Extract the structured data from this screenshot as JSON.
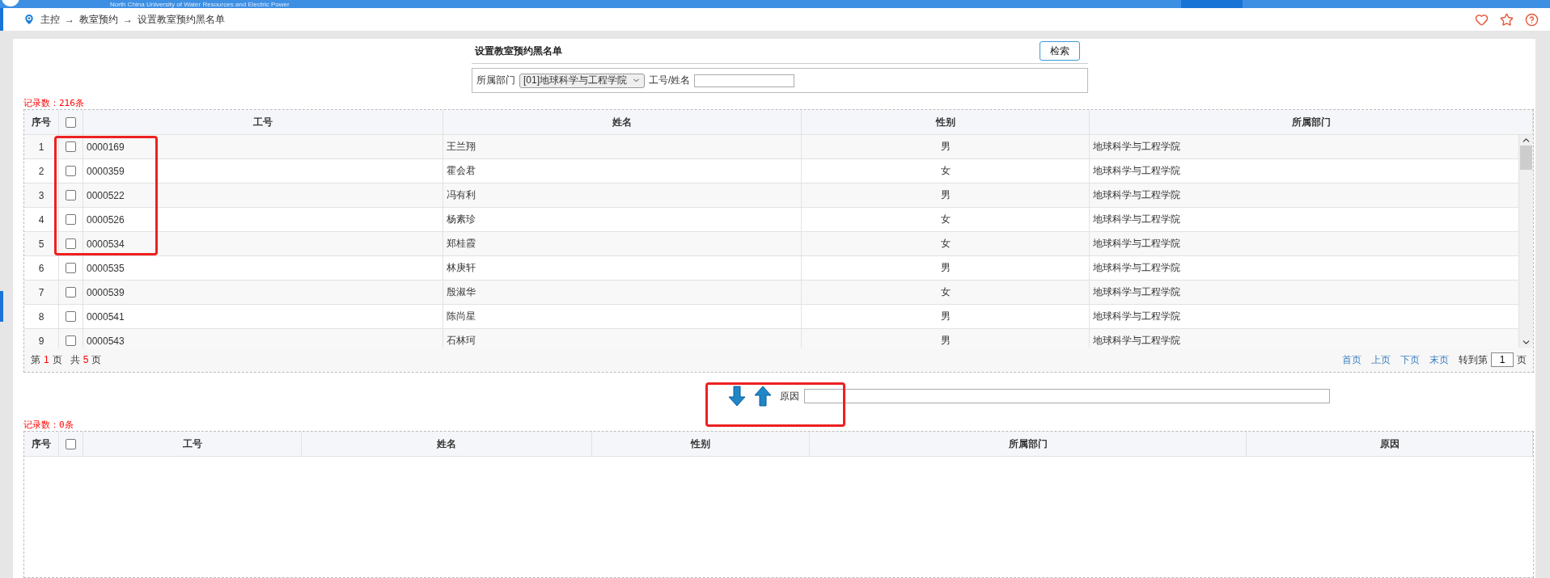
{
  "top_bar": {
    "caption": "North China University of Water Resources and Electric Power"
  },
  "breadcrumb": {
    "items": [
      "主控",
      "教室预约",
      "设置教室预约黑名单"
    ],
    "separators": [
      "→",
      "→"
    ]
  },
  "form": {
    "title": "设置教室预约黑名单",
    "search_button": "检索",
    "department_label": "所属部门",
    "department_value": "[01]地球科学与工程学院",
    "id_name_label": "工号/姓名"
  },
  "candidates": {
    "record_count": "记录数：216条",
    "columns": [
      "序号",
      "工号",
      "姓名",
      "性别",
      "所属部门"
    ],
    "header_checked": false,
    "rows": [
      {
        "index": "1",
        "checked": false,
        "id": "0000169",
        "name": "王兰翔",
        "gender": "男",
        "department": "地球科学与工程学院"
      },
      {
        "index": "2",
        "checked": false,
        "id": "0000359",
        "name": "霍会君",
        "gender": "女",
        "department": "地球科学与工程学院"
      },
      {
        "index": "3",
        "checked": false,
        "id": "0000522",
        "name": "冯有利",
        "gender": "男",
        "department": "地球科学与工程学院"
      },
      {
        "index": "4",
        "checked": false,
        "id": "0000526",
        "name": "杨素珍",
        "gender": "女",
        "department": "地球科学与工程学院"
      },
      {
        "index": "5",
        "checked": false,
        "id": "0000534",
        "name": "郑桂霞",
        "gender": "女",
        "department": "地球科学与工程学院"
      },
      {
        "index": "6",
        "checked": false,
        "id": "0000535",
        "name": "林庚轩",
        "gender": "男",
        "department": "地球科学与工程学院"
      },
      {
        "index": "7",
        "checked": false,
        "id": "0000539",
        "name": "殷淑华",
        "gender": "女",
        "department": "地球科学与工程学院"
      },
      {
        "index": "8",
        "checked": false,
        "id": "0000541",
        "name": "陈尚星",
        "gender": "男",
        "department": "地球科学与工程学院"
      },
      {
        "index": "9",
        "checked": false,
        "id": "0000543",
        "name": "石林珂",
        "gender": "男",
        "department": "地球科学与工程学院"
      }
    ],
    "pager": {
      "page_prefix": "第",
      "current": "1",
      "page_suffix": "页",
      "total_prefix": "共",
      "total": "5",
      "total_suffix": "页",
      "links": [
        "首页",
        "上页",
        "下页",
        "末页"
      ],
      "goto_prefix": "转到第",
      "goto_value": "1",
      "goto_suffix": "页"
    }
  },
  "transfer": {
    "reason_label": "原因"
  },
  "blacklist": {
    "record_count": "记录数：0条",
    "columns": [
      "序号",
      "工号",
      "姓名",
      "性别",
      "所属部门",
      "原因"
    ],
    "header_checked": false
  }
}
